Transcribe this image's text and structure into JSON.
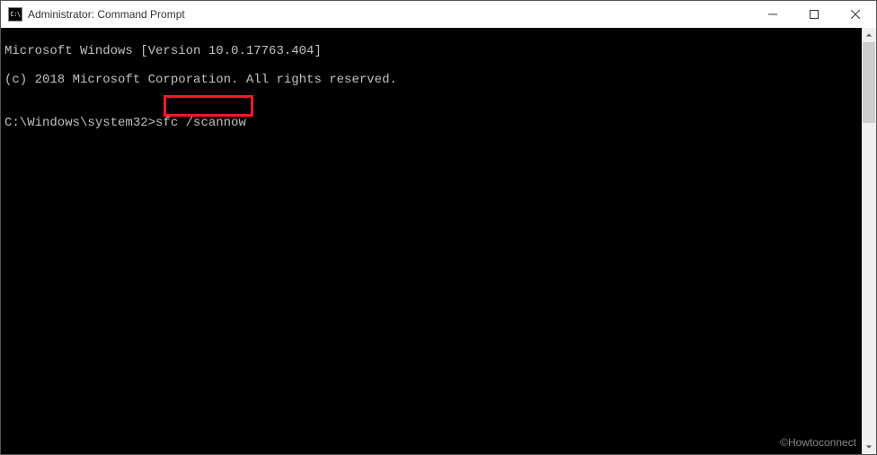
{
  "titlebar": {
    "icon_label": "C:\\",
    "title": "Administrator: Command Prompt"
  },
  "terminal": {
    "line1": "Microsoft Windows [Version 10.0.17763.404]",
    "line2": "(c) 2018 Microsoft Corporation. All rights reserved.",
    "blank1": "",
    "prompt": "C:\\Windows\\system32>",
    "command": "sfc /scannow"
  },
  "branding": "©Howtoconnect"
}
